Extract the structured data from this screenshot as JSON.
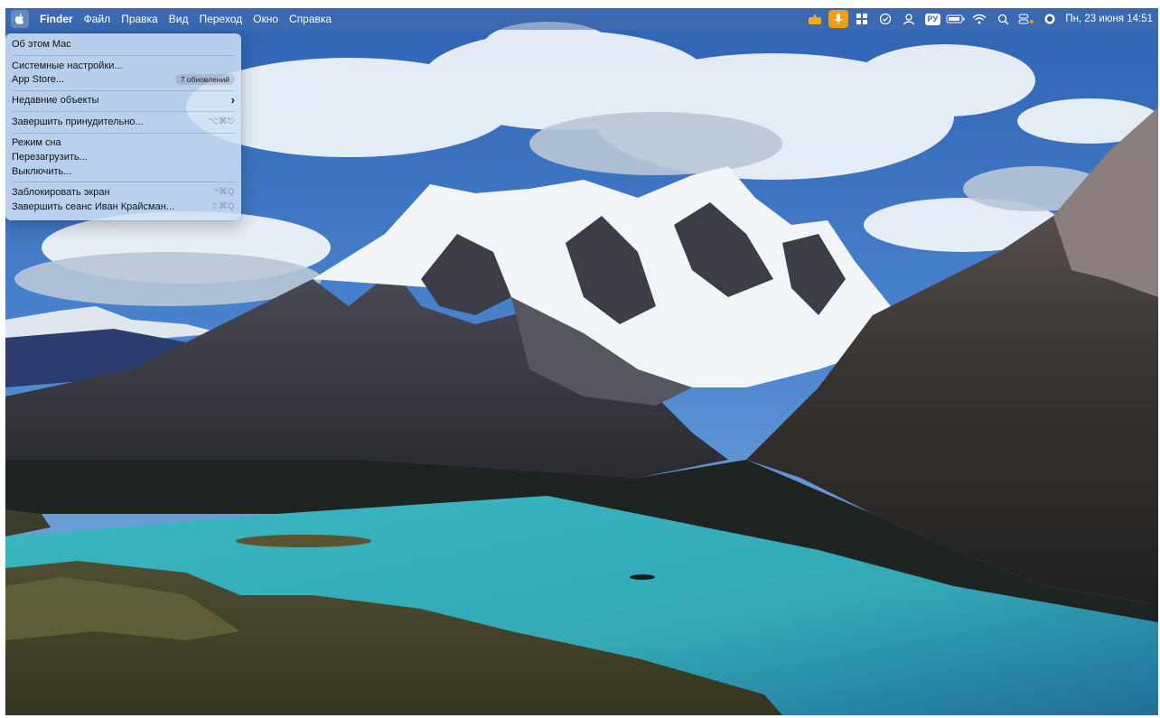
{
  "menubar": {
    "app_name": "Finder",
    "menus": [
      "Файл",
      "Правка",
      "Вид",
      "Переход",
      "Окно",
      "Справка"
    ],
    "status_icons": [
      "keyboard-brightness-icon",
      "microphone-icon",
      "window-grid-icon",
      "check-circle-icon",
      "dropbox-icon",
      "input-source-icon",
      "battery-icon",
      "wifi-icon",
      "search-icon",
      "control-center-icon",
      "siri-icon"
    ],
    "input_source": "РУ",
    "clock": "Пн, 23 июня 14:51"
  },
  "apple_menu": {
    "about": "Об этом Mac",
    "settings": "Системные настройки...",
    "app_store": "App Store...",
    "app_store_badge": "7 обновлений",
    "recent_items": "Недавние объекты",
    "force_quit": "Завершить принудительно...",
    "force_quit_shortcut": "⌥⌘⎋",
    "sleep": "Режим сна",
    "restart": "Перезагрузить...",
    "shut_down": "Выключить...",
    "lock_screen": "Заблокировать экран",
    "lock_screen_shortcut": "^⌘Q",
    "log_out": "Завершить сеанс Иван Крайсман...",
    "log_out_shortcut": "⇧⌘Q"
  },
  "colors": {
    "menubar": "#466eaa",
    "menu_bg": "#cde0f4",
    "lake": "#3fb0b8",
    "sky": "#3f78c6",
    "mic_accent": "#f39c12"
  }
}
